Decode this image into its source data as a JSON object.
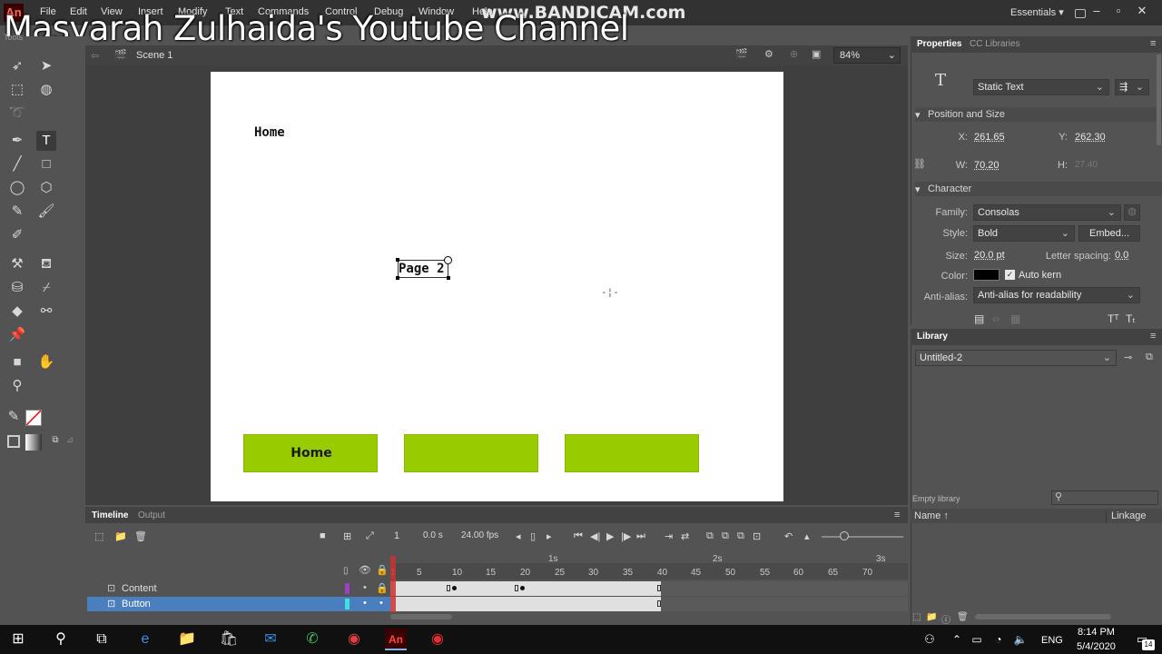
{
  "menubar": {
    "logo": "An",
    "items": [
      "File",
      "Edit",
      "View",
      "Insert",
      "Modify",
      "Text",
      "Commands",
      "Control",
      "Debug",
      "Window",
      "Help"
    ],
    "workspace": "Essentials",
    "watermark": "Masyarah Zulhaida's Youtube Channel",
    "bandicam": "www.BANDICAM.com"
  },
  "editbar": {
    "scene": "Scene 1",
    "zoom": "84%"
  },
  "stage": {
    "home_label": "Home",
    "selected_text": "Page 2",
    "buttons": [
      {
        "label": "Home"
      },
      {
        "label": ""
      },
      {
        "label": ""
      }
    ],
    "button_color": "#99cc00"
  },
  "properties": {
    "tabs": [
      "Properties",
      "CC Libraries"
    ],
    "text_type": "Static Text",
    "position_section": "Position and Size",
    "x_label": "X:",
    "x": "261.65",
    "y_label": "Y:",
    "y": "262.30",
    "w_label": "W:",
    "w": "70.20",
    "h_label": "H:",
    "h": "27.40",
    "character_section": "Character",
    "family_label": "Family:",
    "family": "Consolas",
    "style_label": "Style:",
    "style": "Bold",
    "embed": "Embed...",
    "size_label": "Size:",
    "size": "20.0 pt",
    "letter_spacing_label": "Letter spacing:",
    "letter_spacing": "0.0",
    "color_label": "Color:",
    "color": "#000000",
    "auto_kern": "Auto kern",
    "antialias_label": "Anti-alias:",
    "antialias": "Anti-alias for readability"
  },
  "library": {
    "tab": "Library",
    "document": "Untitled-2",
    "empty": "Empty library",
    "name_col": "Name",
    "linkage_col": "Linkage"
  },
  "timeline": {
    "tabs": [
      "Timeline",
      "Output"
    ],
    "frame": "1",
    "time": "0.0",
    "time_unit": "s",
    "fps": "24.00",
    "fps_unit": "fps",
    "seconds": [
      "1s",
      "2s",
      "3s"
    ],
    "frame_numbers": [
      "1",
      "5",
      "10",
      "15",
      "20",
      "25",
      "30",
      "35",
      "40",
      "45",
      "50",
      "55",
      "60",
      "65",
      "70"
    ],
    "layers": [
      {
        "name": "Content",
        "color": "#a040c0"
      },
      {
        "name": "Button",
        "color": "#40e0e0"
      }
    ]
  },
  "taskbar": {
    "lang": "ENG",
    "time": "8:14 PM",
    "date": "5/4/2020",
    "notifications": "14"
  }
}
